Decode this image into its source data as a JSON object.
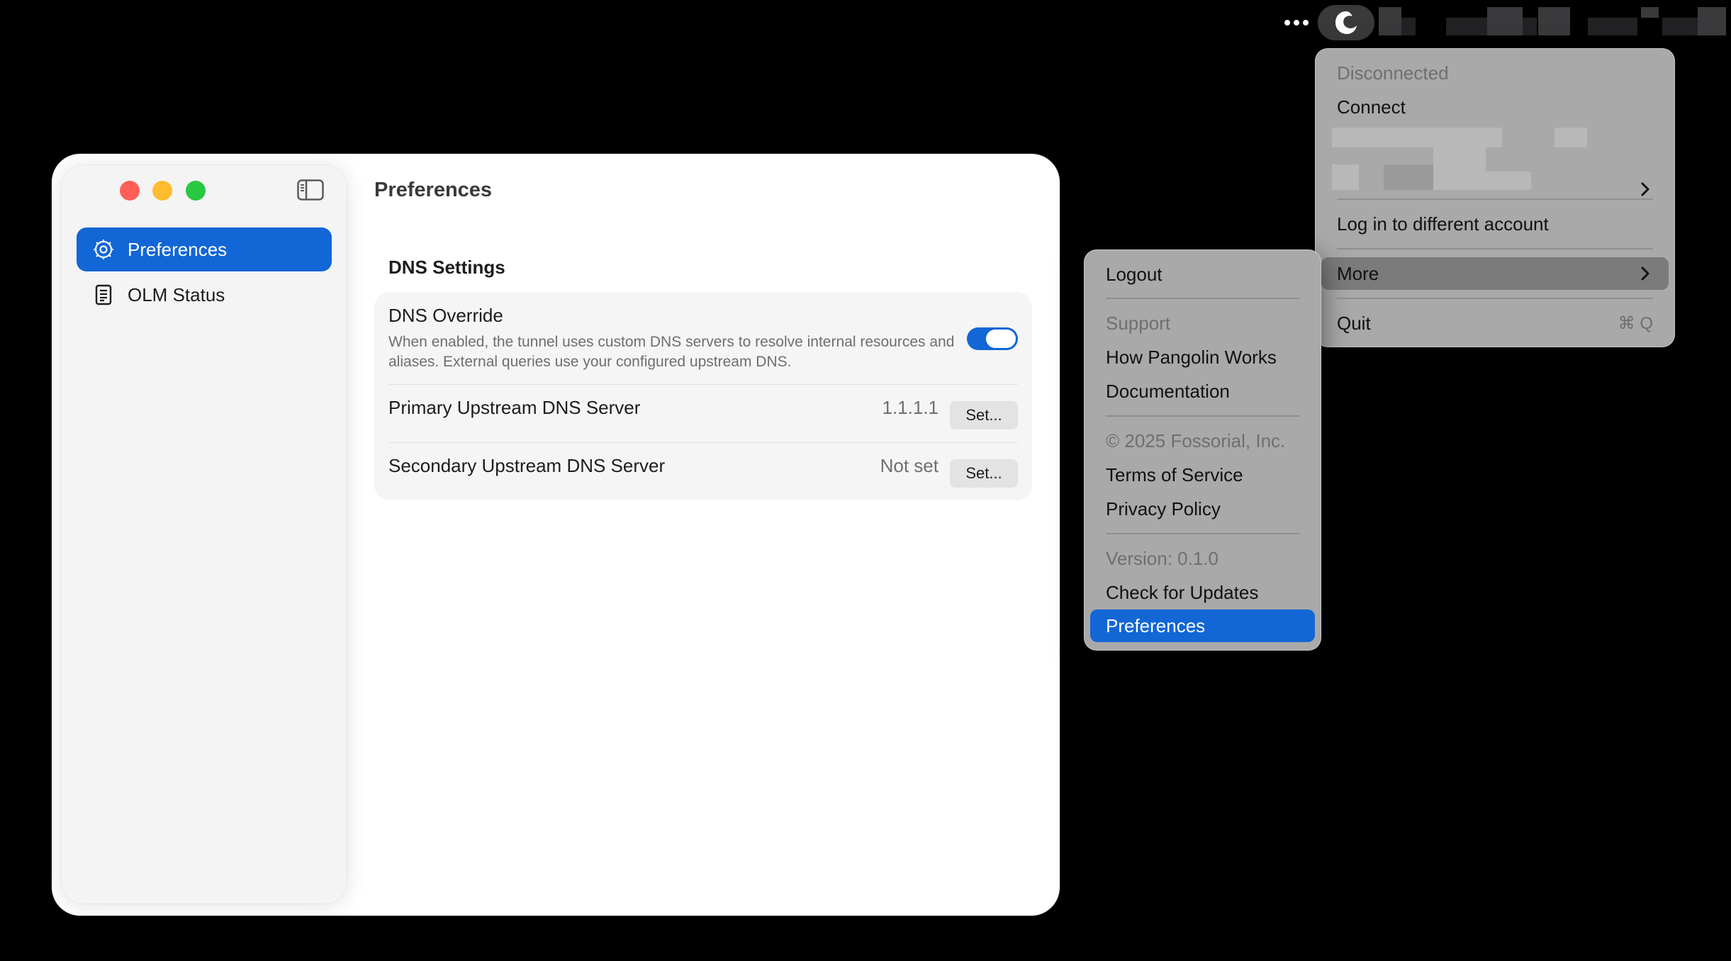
{
  "menubar": {
    "more_icon": "ellipsis-icon",
    "app_icon": "pangolin-icon"
  },
  "window": {
    "sidebar": {
      "items": [
        {
          "label": "Preferences",
          "icon": "gear-icon",
          "active": true
        },
        {
          "label": "OLM Status",
          "icon": "document-icon",
          "active": false
        }
      ]
    },
    "title": "Preferences",
    "section_title": "DNS Settings",
    "dns_override": {
      "title": "DNS Override",
      "description": "When enabled, the tunnel uses custom DNS servers to resolve internal resources and aliases. External queries use your configured upstream DNS.",
      "enabled": true
    },
    "primary": {
      "label": "Primary Upstream DNS Server",
      "value": "1.1.1.1",
      "button": "Set..."
    },
    "secondary": {
      "label": "Secondary Upstream DNS Server",
      "value": "Not set",
      "button": "Set..."
    }
  },
  "main_menu": {
    "status": "Disconnected",
    "connect": "Connect",
    "login_other": "Log in to different account",
    "more": "More",
    "quit": "Quit",
    "quit_shortcut": "⌘ Q"
  },
  "more_menu": {
    "logout": "Logout",
    "support_header": "Support",
    "how_works": "How Pangolin Works",
    "documentation": "Documentation",
    "copyright": "© 2025 Fossorial, Inc.",
    "terms": "Terms of Service",
    "privacy": "Privacy Policy",
    "version": "Version: 0.1.0",
    "check_updates": "Check for Updates",
    "preferences": "Preferences"
  },
  "colors": {
    "accent": "#1266d6",
    "menu_bg": "#a9a9a9",
    "close": "#ff5f57",
    "minimize": "#febc2e",
    "maximize": "#28c840"
  }
}
